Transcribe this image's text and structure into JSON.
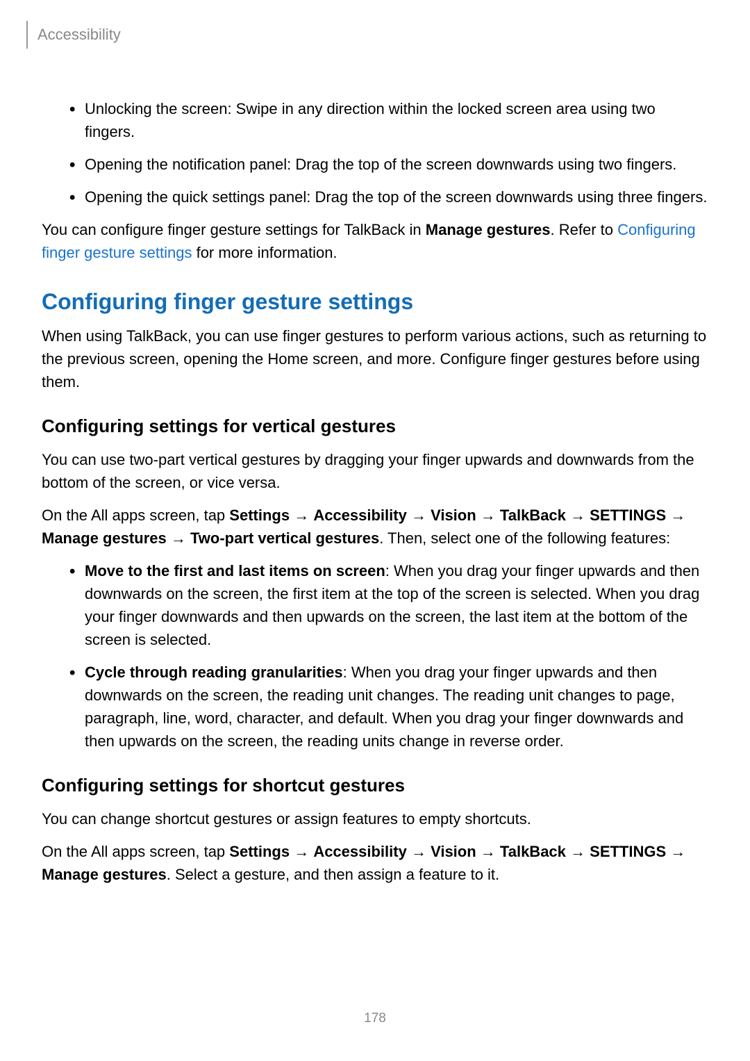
{
  "header": {
    "breadcrumb": "Accessibility"
  },
  "bullets1": [
    "Unlocking the screen: Swipe in any direction within the locked screen area using two fingers.",
    "Opening the notification panel: Drag the top of the screen downwards using two fingers.",
    "Opening the quick settings panel: Drag the top of the screen downwards using three fingers."
  ],
  "para1_a": "You can configure finger gesture settings for TalkBack in ",
  "para1_bold": "Manage gestures",
  "para1_b": ". Refer to ",
  "para1_link": "Configuring finger gesture settings",
  "para1_c": " for more information.",
  "h2": "Configuring finger gesture settings",
  "para2": "When using TalkBack, you can use finger gestures to perform various actions, such as returning to the previous screen, opening the Home screen, and more. Configure finger gestures before using them.",
  "h3a": "Configuring settings for vertical gestures",
  "para3": "You can use two-part vertical gestures by dragging your finger upwards and downwards from the bottom of the screen, or vice versa.",
  "para4_a": "On the All apps screen, tap ",
  "para4_b": ". Then, select one of the following features:",
  "path1": [
    "Settings",
    "Accessibility",
    "Vision",
    "TalkBack",
    "SETTINGS",
    "Manage gestures",
    "Two-part vertical gestures"
  ],
  "arrow": " → ",
  "bullets2": [
    {
      "bold": "Move to the first and last items on screen",
      "rest": ": When you drag your finger upwards and then downwards on the screen, the first item at the top of the screen is selected. When you drag your finger downwards and then upwards on the screen, the last item at the bottom of the screen is selected."
    },
    {
      "bold": "Cycle through reading granularities",
      "rest": ": When you drag your finger upwards and then downwards on the screen, the reading unit changes. The reading unit changes to page, paragraph, line, word, character, and default. When you drag your finger downwards and then upwards on the screen, the reading units change in reverse order."
    }
  ],
  "h3b": "Configuring settings for shortcut gestures",
  "para5": "You can change shortcut gestures or assign features to empty shortcuts.",
  "para6_a": "On the All apps screen, tap ",
  "para6_b": ". Select a gesture, and then assign a feature to it.",
  "path2": [
    "Settings",
    "Accessibility",
    "Vision",
    "TalkBack",
    "SETTINGS",
    "Manage gestures"
  ],
  "page_number": "178"
}
